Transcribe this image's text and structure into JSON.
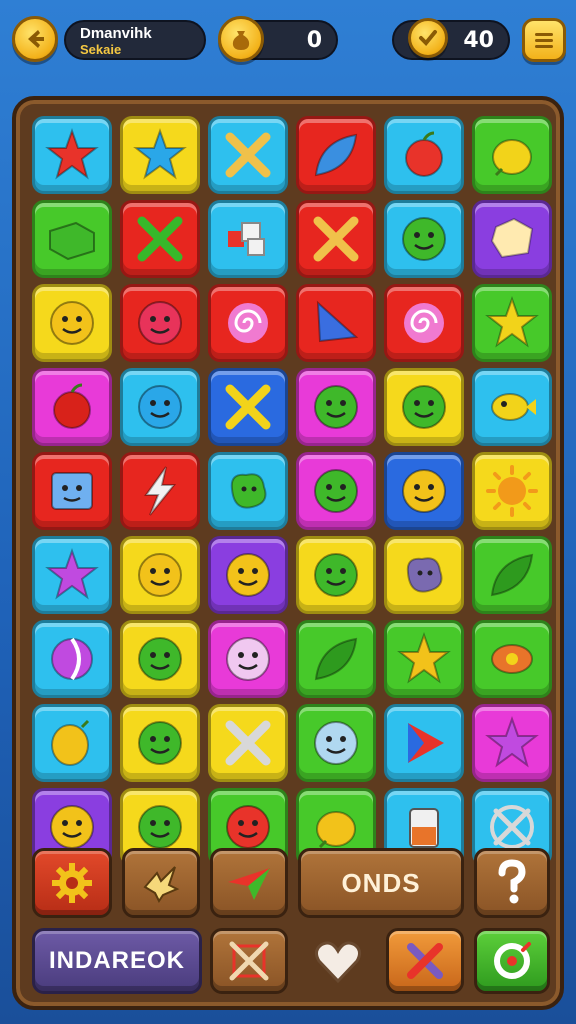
{
  "hud": {
    "back_icon": "arrow-left-icon",
    "title_line1": "Dmanvihk",
    "title_line2": "Sekaie",
    "coins_icon": "money-bag-icon",
    "coins_value": "0",
    "gems_icon": "check-coin-icon",
    "gems_value": "40",
    "menu_icon": "menu-icon"
  },
  "board": {
    "rows": [
      [
        {
          "color": "#2ec0ee",
          "icon": "star-icon",
          "fg": "#e8332a"
        },
        {
          "color": "#f5d91c",
          "icon": "star-icon",
          "fg": "#2aa7e8"
        },
        {
          "color": "#2ec0ee",
          "icon": "cross-icon",
          "fg": "#f0c14a"
        },
        {
          "color": "#e7261f",
          "icon": "leaf-icon",
          "fg": "#3a8fe0"
        },
        {
          "color": "#2ec0ee",
          "icon": "apple-icon",
          "fg": "#e8332a"
        },
        {
          "color": "#47c92a",
          "icon": "fruit-icon",
          "fg": "#f2d31a"
        }
      ],
      [
        {
          "color": "#47c92a",
          "icon": "block-icon",
          "fg": "#3fb82a"
        },
        {
          "color": "#e7261f",
          "icon": "cross-icon",
          "fg": "#37b82a"
        },
        {
          "color": "#2ec0ee",
          "icon": "cubes-icon",
          "fg": "#f2f2f2"
        },
        {
          "color": "#e7261f",
          "icon": "cross-icon",
          "fg": "#f0c14a"
        },
        {
          "color": "#2ec0ee",
          "icon": "face-icon",
          "fg": "#3fb82a"
        },
        {
          "color": "#8a3ee0",
          "icon": "gem-icon",
          "fg": "#ffeab0"
        }
      ],
      [
        {
          "color": "#f5d91c",
          "icon": "face-icon",
          "fg": "#f2c21a"
        },
        {
          "color": "#e7261f",
          "icon": "face-icon",
          "fg": "#e8335a"
        },
        {
          "color": "#e7261f",
          "icon": "swirl-icon",
          "fg": "#f07ad0"
        },
        {
          "color": "#e7261f",
          "icon": "flag-icon",
          "fg": "#3a6ee0"
        },
        {
          "color": "#e7261f",
          "icon": "swirl-icon",
          "fg": "#f07ad0"
        },
        {
          "color": "#47c92a",
          "icon": "star-icon",
          "fg": "#f2d31a"
        }
      ],
      [
        {
          "color": "#e83ad8",
          "icon": "apple-icon",
          "fg": "#d8221a"
        },
        {
          "color": "#2ec0ee",
          "icon": "face-icon",
          "fg": "#2aa7e8"
        },
        {
          "color": "#2a6ae0",
          "icon": "cross-icon",
          "fg": "#f2d31a"
        },
        {
          "color": "#e83ad8",
          "icon": "face-icon",
          "fg": "#3fb82a"
        },
        {
          "color": "#f5d91c",
          "icon": "face-icon",
          "fg": "#3fb82a"
        },
        {
          "color": "#2ec0ee",
          "icon": "fish-icon",
          "fg": "#f2d31a"
        }
      ],
      [
        {
          "color": "#e7261f",
          "icon": "box-face-icon",
          "fg": "#6fb0f0"
        },
        {
          "color": "#e7261f",
          "icon": "lightning-icon",
          "fg": "#f2f2f2"
        },
        {
          "color": "#2ec0ee",
          "icon": "blob-icon",
          "fg": "#3fb82a"
        },
        {
          "color": "#e83ad8",
          "icon": "face-icon",
          "fg": "#3fb82a"
        },
        {
          "color": "#2a6ae0",
          "icon": "face-icon",
          "fg": "#f2c21a"
        },
        {
          "color": "#f5d91c",
          "icon": "sun-icon",
          "fg": "#f29a1a"
        }
      ],
      [
        {
          "color": "#2ec0ee",
          "icon": "star-icon",
          "fg": "#c04ae0"
        },
        {
          "color": "#f5d91c",
          "icon": "face-icon",
          "fg": "#f2c21a"
        },
        {
          "color": "#8a3ee0",
          "icon": "face-icon",
          "fg": "#f2c21a"
        },
        {
          "color": "#f5d91c",
          "icon": "face-icon",
          "fg": "#3fb82a"
        },
        {
          "color": "#f5d91c",
          "icon": "blob-icon",
          "fg": "#7a6ab0"
        },
        {
          "color": "#47c92a",
          "icon": "leaf-icon",
          "fg": "#2e9a1e"
        }
      ],
      [
        {
          "color": "#2ec0ee",
          "icon": "ball-icon",
          "fg": "#c04ae0"
        },
        {
          "color": "#f5d91c",
          "icon": "face-icon",
          "fg": "#3fb82a"
        },
        {
          "color": "#e83ad8",
          "icon": "face-icon",
          "fg": "#f0c8f0"
        },
        {
          "color": "#47c92a",
          "icon": "leaf-icon",
          "fg": "#2e9a1e"
        },
        {
          "color": "#47c92a",
          "icon": "star-icon",
          "fg": "#f2c21a"
        },
        {
          "color": "#47c92a",
          "icon": "candy-icon",
          "fg": "#e8742a"
        }
      ],
      [
        {
          "color": "#2ec0ee",
          "icon": "lemon-icon",
          "fg": "#f2c21a"
        },
        {
          "color": "#f5d91c",
          "icon": "face-icon",
          "fg": "#3fb82a"
        },
        {
          "color": "#f5d91c",
          "icon": "cross-icon",
          "fg": "#d8d8d8"
        },
        {
          "color": "#47c92a",
          "icon": "face-icon",
          "fg": "#b0d8f0"
        },
        {
          "color": "#2ec0ee",
          "icon": "play-icon",
          "fg": "#e8332a"
        },
        {
          "color": "#e83ad8",
          "icon": "star-icon",
          "fg": "#c04ae0"
        }
      ],
      [
        {
          "color": "#8a3ee0",
          "icon": "face-icon",
          "fg": "#f2c21a"
        },
        {
          "color": "#f5d91c",
          "icon": "face-icon",
          "fg": "#3fb82a"
        },
        {
          "color": "#47c92a",
          "icon": "face-icon",
          "fg": "#e8332a"
        },
        {
          "color": "#47c92a",
          "icon": "fruit-icon",
          "fg": "#f2c21a"
        },
        {
          "color": "#2ec0ee",
          "icon": "potion-icon",
          "fg": "#e8742a"
        },
        {
          "color": "#2ec0ee",
          "icon": "crossed-circle-icon",
          "fg": "#d8d8d8"
        }
      ]
    ]
  },
  "controls": {
    "settings_icon": "gear-icon",
    "bird_icon": "bird-icon",
    "plane_icon": "paper-plane-icon",
    "odds_label": "ONDS",
    "help_icon": "question-icon",
    "inventory_label": "INDAREOK",
    "cancel_icon": "crossed-box-icon",
    "heart_icon": "heart-icon",
    "tools_icon": "tools-icon",
    "target_icon": "target-icon"
  }
}
